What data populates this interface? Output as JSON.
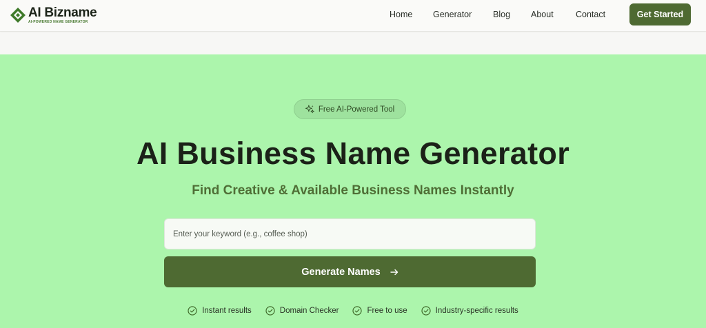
{
  "header": {
    "logo_text": "AI Bizname",
    "logo_tagline": "AI-POWERED NAME GENERATOR",
    "nav": [
      "Home",
      "Generator",
      "Blog",
      "About",
      "Contact"
    ],
    "cta_label": "Get Started"
  },
  "hero": {
    "badge": "Free AI-Powered Tool",
    "title": "AI Business Name Generator",
    "subtitle": "Find Creative & Available Business Names Instantly",
    "input_placeholder": "Enter your keyword (e.g., coffee shop)",
    "button_label": "Generate Names",
    "features": [
      "Instant results",
      "Domain Checker",
      "Free to use",
      "Industry-specific results"
    ]
  },
  "icons": {
    "logo": "diamond-logo-icon",
    "badge": "sparkle-icon",
    "button": "arrow-right-icon",
    "feature": "check-circle-icon"
  },
  "colors": {
    "brand": "#4e6a32",
    "hero_bg": "#acf5ac",
    "subtitle": "#4f6e36",
    "header_bg": "#fafaf8"
  }
}
